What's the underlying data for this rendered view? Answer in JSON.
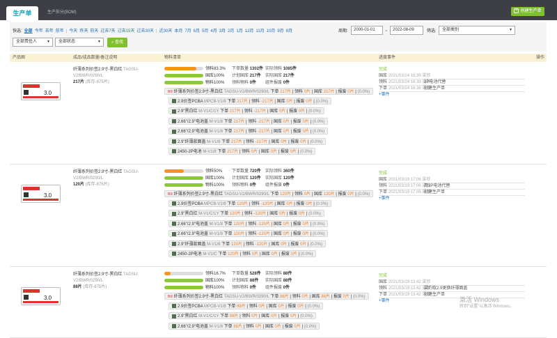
{
  "tabs": [
    {
      "label": "生产单"
    },
    {
      "label": "生产拆分(BOM)"
    }
  ],
  "create_button": "创建生产单",
  "filters": {
    "quick_label": "快选:",
    "quick_links": [
      "全部",
      "今年",
      "去年",
      "前年",
      "今天",
      "昨天",
      "前天",
      "过去7天",
      "过去15天",
      "过去30天",
      "近30天",
      "本月",
      "7月",
      "6月",
      "5月",
      "4月",
      "3月",
      "2月",
      "1月",
      "12月",
      "11月",
      "10月",
      "9月",
      "8月"
    ],
    "period_label": "周期:",
    "date_from": "2000-01-01",
    "date_sep": "~",
    "date_to": "2022-08-09",
    "category_label": "筛选:",
    "category": "全部类别",
    "owner": "全部责任人",
    "status": "全部状态",
    "query_button": "查找"
  },
  "columns": {
    "image": "产品图",
    "product": "成品/成品数量/备注说明",
    "materials": "物料清单",
    "events": "进度事件",
    "action": "操作"
  },
  "orders": [
    {
      "product_name": "纤薄系列价签2.9寸-黑白红",
      "product_code": "TAGSU-V2/BWR/0290/L",
      "qty": "217片",
      "stock": "(库存-875片)",
      "thumb_text": "3.0",
      "progress": [
        {
          "pct": "领料83.3%",
          "fill": 0.83,
          "color": "#f7941e",
          "mid_label": "下单数量",
          "mid_val": "1302件",
          "right_label": "实际领料",
          "right_val": "1085件"
        },
        {
          "pct": "国库100%",
          "fill": 1.0,
          "color": "#8dc63f",
          "mid_label": "计划国库",
          "mid_val": "217件",
          "right_label": "实际国库",
          "right_val": "217件"
        },
        {
          "pct": "物料100%",
          "fill": 1.0,
          "color": "#8dc63f",
          "mid_label": "领料物料",
          "mid_val": "0件",
          "right_label": "组件报废",
          "right_val": "0件"
        }
      ],
      "main_item": {
        "tag": "Bill",
        "name": "纤薄系列价签2.9寸-黑白红",
        "code": "TAGSU-V2/BWR/0290/L",
        "order": "下单",
        "order_val": "217片",
        "pick": "领料",
        "pick_val": "0片",
        "stock": "国库",
        "stock_val": "217片",
        "scrap": "报废",
        "scrap_val": "0片",
        "pct": "(0.0%)"
      },
      "sub_items": [
        {
          "name": "2.9价签PCBA",
          "code": "MPCB-V1/8",
          "order_val": "217片",
          "pick_val": "-217片",
          "stock_val": "0片",
          "scrap_val": "0片",
          "pct": "(0.0%)"
        },
        {
          "name": "2.9\"黑白红",
          "code": "M-V1/C/1Y",
          "order_val": "217片",
          "pick_val": "-217片",
          "stock_val": "0片",
          "scrap_val": "0片",
          "pct": "(0.0%)"
        },
        {
          "name": "2.66\"/2.9\"电池盖",
          "code": "M-V1/8",
          "order_val": "217片",
          "pick_val": "-217片",
          "stock_val": "0片",
          "scrap_val": "0片",
          "pct": "(0.0%)"
        },
        {
          "name": "2.66\"/2.9\"电池盖",
          "code": "M-V1/8",
          "order_val": "217片",
          "pick_val": "-217片",
          "stock_val": "0片",
          "scrap_val": "0片",
          "pct": "(0.0%)"
        },
        {
          "name": "2.9\"纤薄款面盖",
          "code": "M-V1/8",
          "order_val": "217片",
          "pick_val": "-217片",
          "stock_val": "0片",
          "scrap_val": "0片",
          "pct": "(0.0%)"
        },
        {
          "name": "2450-2P电池",
          "code": "M-V1/8",
          "order_val": "217片",
          "pick_val": "0片",
          "stock_val": "0片",
          "scrap_val": "0片",
          "pct": "(0.0%)"
        }
      ],
      "status": "完成",
      "events": [
        {
          "type": "国库",
          "time": "2021/03/24 16:39 梁欣",
          "desc": ""
        },
        {
          "type": "领料",
          "time": "2021/03/24 16:39 梁欣",
          "desc": "3P电池代替"
        },
        {
          "type": "下单",
          "time": "2021/03/24 16:38 梁欣",
          "desc": "创建生产单"
        }
      ],
      "more": "+事件"
    },
    {
      "product_name": "纤薄系列价签2.9寸-黑白红",
      "product_code": "TAGSU-V2/BWR/0290/L",
      "qty": "120片",
      "stock": "(库存-875片)",
      "thumb_text": "3.0",
      "progress": [
        {
          "pct": "领料50%",
          "fill": 0.5,
          "color": "#f7941e",
          "mid_label": "下单数量",
          "mid_val": "720件",
          "right_label": "实际领料",
          "right_val": "360件"
        },
        {
          "pct": "国库100%",
          "fill": 1.0,
          "color": "#8dc63f",
          "mid_label": "计划国库",
          "mid_val": "120件",
          "right_label": "实际国库",
          "right_val": "120件"
        },
        {
          "pct": "物料100%",
          "fill": 1.0,
          "color": "#8dc63f",
          "mid_label": "领料物料",
          "mid_val": "0件",
          "right_label": "组件报废",
          "right_val": "0件"
        }
      ],
      "main_item": {
        "tag": "Bill",
        "name": "纤薄系列价签2.9寸-黑白红",
        "code": "TAGSU-V2/BWR/0290/L",
        "order": "下单",
        "order_val": "120片",
        "pick": "领料",
        "pick_val": "0片",
        "stock": "国库",
        "stock_val": "120片",
        "scrap": "报废",
        "scrap_val": "0片",
        "pct": "(0.0%)"
      },
      "sub_items": [
        {
          "name": "2.9价签PCBA",
          "code": "MPCB-V1/8",
          "order_val": "120片",
          "pick_val": "-120片",
          "stock_val": "0片",
          "scrap_val": "0片",
          "pct": "(0.0%)"
        },
        {
          "name": "2.9\"黑白红",
          "code": "M-V1/C/1Y",
          "order_val": "120片",
          "pick_val": "-120片",
          "stock_val": "0片",
          "scrap_val": "0片",
          "pct": "(0.0%)"
        },
        {
          "name": "2.66\"/2.9\"电池盖",
          "code": "M-V1/8",
          "order_val": "120片",
          "pick_val": "-120片",
          "stock_val": "0片",
          "scrap_val": "0片",
          "pct": "(0.0%)"
        },
        {
          "name": "2.66\"/2.9\"电池盖",
          "code": "M-V1/8",
          "order_val": "120片",
          "pick_val": "-120片",
          "stock_val": "0片",
          "scrap_val": "0片",
          "pct": "(0.0%)"
        },
        {
          "name": "2.9\"纤薄款面盖",
          "code": "M-V1/8",
          "order_val": "120片",
          "pick_val": "-120片",
          "stock_val": "0片",
          "scrap_val": "0片",
          "pct": "(0.0%)"
        },
        {
          "name": "2450-2P电池",
          "code": "M-V1/C",
          "order_val": "120片",
          "pick_val": "0片",
          "stock_val": "0片",
          "scrap_val": "0片",
          "pct": "(0.0%)"
        }
      ],
      "status": "完成",
      "events": [
        {
          "type": "国库",
          "time": "2021/03/19 17:06 梁欣",
          "desc": ""
        },
        {
          "type": "领料",
          "time": "2021/03/19 17:06 梁欣",
          "desc": "用3P电池代替"
        },
        {
          "type": "下单",
          "time": "2021/03/19 17:05 梁欣",
          "desc": "创建生产单"
        }
      ],
      "more": "+事件"
    },
    {
      "product_name": "纤薄系列价签2.9寸-黑白红",
      "product_code": "TAGSU-V2/BWR/0290/L",
      "qty": "88片",
      "stock": "(库存-875片)",
      "thumb_text": "3.0",
      "progress": [
        {
          "pct": "领料16.7%",
          "fill": 0.167,
          "color": "#f7941e",
          "mid_label": "下单数量",
          "mid_val": "528件",
          "right_label": "实际领料",
          "right_val": "88件"
        },
        {
          "pct": "国库100%",
          "fill": 1.0,
          "color": "#8dc63f",
          "mid_label": "计划国库",
          "mid_val": "88件",
          "right_label": "实际国库",
          "right_val": "88件"
        },
        {
          "pct": "物料100%",
          "fill": 1.0,
          "color": "#8dc63f",
          "mid_label": "领料物料",
          "mid_val": "0件",
          "right_label": "组件报废",
          "right_val": "0件"
        }
      ],
      "main_item": {
        "tag": "Bill",
        "name": "纤薄系列价签2.9寸-黑白红",
        "code": "TAGSU-V2/BWR/0290/L",
        "order": "下单",
        "order_val": "88片",
        "pick": "领料",
        "pick_val": "0片",
        "stock": "国库",
        "stock_val": "88片",
        "scrap": "报废",
        "scrap_val": "0片",
        "pct": "(0.0%)"
      },
      "sub_items": [
        {
          "name": "2.9价签PCBA",
          "code": "MPCB-V1/8",
          "order_val": "88片",
          "pick_val": "0片",
          "stock_val": "0片",
          "scrap_val": "0片",
          "pct": "(0.0%)"
        },
        {
          "name": "2.9\"黑白红",
          "code": "M-V1/C/1Y",
          "order_val": "88片",
          "pick_val": "0片",
          "stock_val": "0片",
          "scrap_val": "0片",
          "pct": "(0.0%)"
        },
        {
          "name": "2.66\"/2.9\"电池盖",
          "code": "M-V1/8",
          "order_val": "88片",
          "pick_val": "0片",
          "stock_val": "0片",
          "scrap_val": "0片",
          "pct": "(0.0%)"
        }
      ],
      "status": "完成",
      "events": [
        {
          "type": "国库",
          "time": "2021/03/19 13:42 梁欣",
          "desc": ""
        },
        {
          "type": "领料",
          "time": "2021/03/19 13:42 梁欣",
          "desc": "梁约取2.9更换纤薄面盖"
        },
        {
          "type": "下单",
          "time": "2021/03/19 13:42 梁欣",
          "desc": "创建生产单"
        }
      ],
      "more": "+事件"
    }
  ],
  "watermark": {
    "line1": "激活 Windows",
    "line2": "转到\"设置\"以激活 Windows。"
  }
}
